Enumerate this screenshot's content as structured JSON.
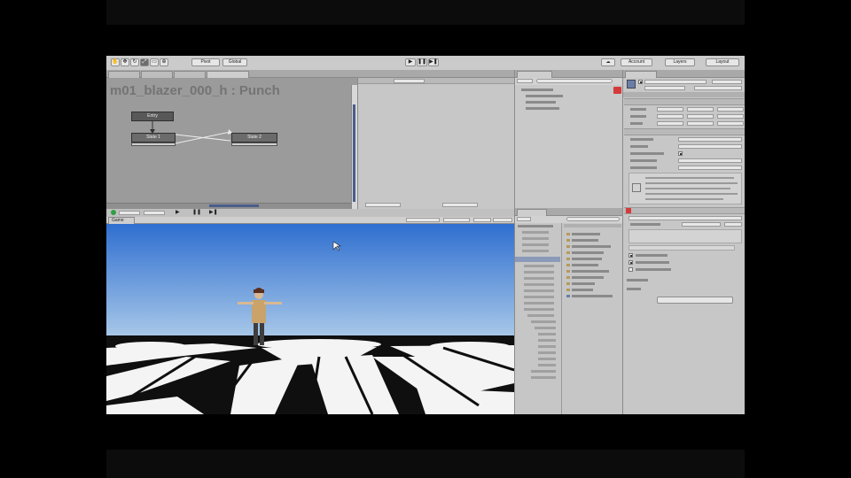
{
  "toolbar": {
    "pivot": "Pivot",
    "global": "Global",
    "collab": "Collab",
    "account": "Account",
    "layers": "Layers",
    "layout": "Layout",
    "icons": {
      "hand": "hand-icon",
      "move": "move-icon",
      "rotate": "rotate-icon",
      "scale": "scale-icon",
      "rect": "rect-icon",
      "play": "play-icon",
      "pause": "pause-icon",
      "step": "step-icon",
      "cloud": "cloud-icon"
    }
  },
  "animator": {
    "title": "m01_blazer_000_h : Punch",
    "nodes": {
      "entry": "Entry",
      "state1": "State 1",
      "state2": "State 2"
    }
  },
  "game": {
    "tab": "Game"
  },
  "colors": {
    "sky_top": "#2f6fd0",
    "sky_bottom": "#a8c8e8",
    "ground": "#0f0f0f",
    "accent_red": "#d43a3a",
    "play_green": "#2ea043"
  }
}
